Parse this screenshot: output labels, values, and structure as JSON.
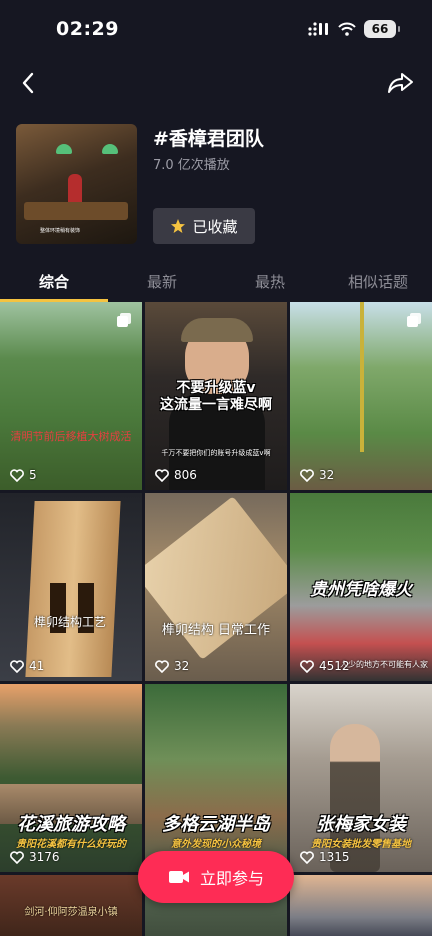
{
  "status": {
    "time": "02:29",
    "battery": "66"
  },
  "topic": {
    "title": "#香樟君团队",
    "plays": "7.0 亿次播放",
    "favorite_label": "已收藏",
    "cover_caption": "整体环境稍有装饰"
  },
  "tabs": [
    {
      "label": "综合",
      "active": true
    },
    {
      "label": "最新",
      "active": false
    },
    {
      "label": "最热",
      "active": false
    },
    {
      "label": "相似话题",
      "active": false
    }
  ],
  "videos": [
    {
      "likes": "5",
      "overlay": "清明节前后移植大树成活",
      "multi": true
    },
    {
      "likes": "806",
      "overlay": "不要升级蓝v\n这流量一言难尽啊",
      "subtitle": "千万不要把你们的账号升级成蓝v啊"
    },
    {
      "likes": "32",
      "multi": true
    },
    {
      "likes": "41",
      "overlay": "榫卯结构工艺"
    },
    {
      "likes": "32",
      "overlay": "榫卯结构 日常工作"
    },
    {
      "likes": "4512",
      "overlay": "贵州凭啥爆火",
      "subtitle": "人少的地方不可能有人家"
    },
    {
      "likes": "3176",
      "overlay": "花溪旅游攻略",
      "subtitle": "贵阳花溪都有什么好玩的"
    },
    {
      "likes": "",
      "overlay": "多格云湖半岛",
      "subtitle": "意外发现的小众秘境"
    },
    {
      "likes": "1315",
      "overlay": "张梅家女装",
      "subtitle": "贵阳女装批发零售基地"
    },
    {
      "overlay": "剑河·仰阿莎温泉小镇"
    },
    {},
    {}
  ],
  "join_button": "立即参与",
  "colors": {
    "accent": "#f5c341",
    "primary": "#fe2c55",
    "background": "#161722"
  }
}
